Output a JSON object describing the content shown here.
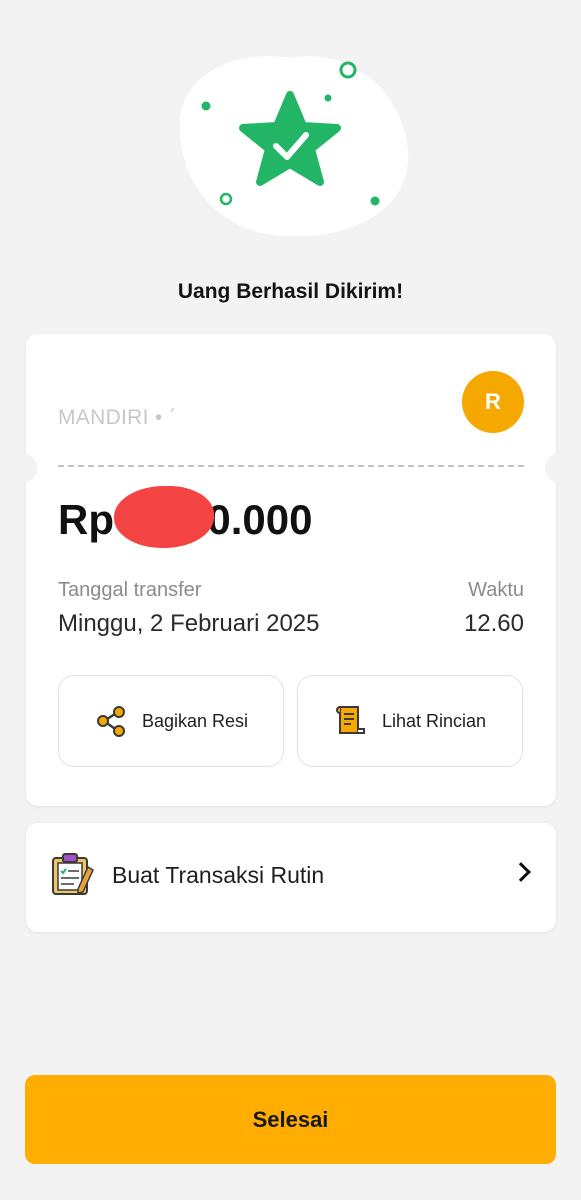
{
  "success": {
    "title": "Uang Berhasil Dikirim!",
    "icon": "star-check-icon"
  },
  "receipt": {
    "bank_name": "MANDIRI • ˊ",
    "avatar_initial": "R",
    "amount": "Rp    000.000",
    "date_label": "Tanggal transfer",
    "date_value": "Minggu, 2 Februari 2025",
    "time_label": "Waktu",
    "time_value": "12.60",
    "share_label": "Bagikan Resi",
    "detail_label": "Lihat Rincian"
  },
  "routine": {
    "label": "Buat Transaksi Rutin"
  },
  "footer": {
    "done_label": "Selesai"
  },
  "colors": {
    "accent": "#ffad00",
    "success": "#22b565",
    "avatar": "#f5a800",
    "background": "#f3f3f3"
  }
}
